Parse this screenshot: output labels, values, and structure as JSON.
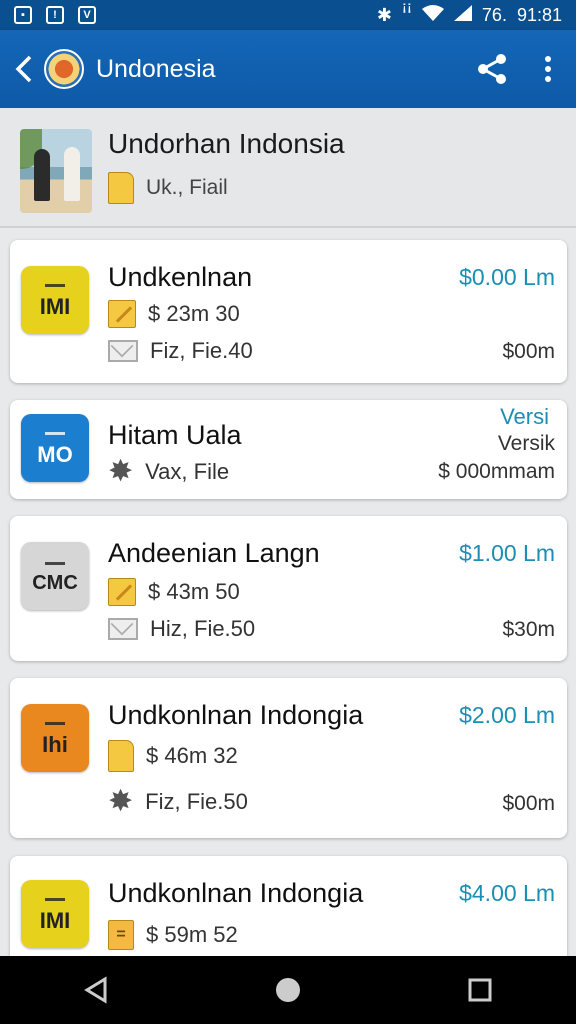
{
  "status": {
    "carrier": "76.",
    "time": "91:81",
    "icons": [
      "sim-icon",
      "alert-icon",
      "vibrate-icon",
      "bluetooth-icon",
      "signal-icon",
      "wifi-icon",
      "cellular-icon"
    ]
  },
  "appbar": {
    "title": "Undonesia",
    "icons": [
      "back-arrow-icon",
      "share-icon",
      "overflow-menu-icon"
    ]
  },
  "header": {
    "title": "Undorhan Indonsia",
    "subtitle": "Uk., Fiail"
  },
  "items": [
    {
      "icon_label": "IMI",
      "icon_color": "#e6d21c",
      "title": "Undkenlnan",
      "price": "$0.00 Lm",
      "line1": "$ 23m 30",
      "line1_icon": "pencil-icon",
      "line2": "Fiz, Fie.40",
      "line2_icon": "mail-icon",
      "line2_right": "$00m"
    },
    {
      "icon_label": "MO",
      "icon_color": "#1b7ecf",
      "title": "Hitam Uala",
      "price": "Versi",
      "price_sub": "Versik",
      "line1": "Vax, File",
      "line1_icon": "gear-icon",
      "line1_right": "$ 000mmam"
    },
    {
      "icon_label": "CMC",
      "icon_color": "#d6d6d6",
      "title": "Andeenian Langn",
      "price": "$1.00 Lm",
      "line1": "$ 43m 50",
      "line1_icon": "pencil-icon",
      "line2": "Hiz, Fie.50",
      "line2_icon": "mail-icon",
      "line2_right": "$30m"
    },
    {
      "icon_label": "Ihi",
      "icon_color": "#e8881e",
      "title": "Undkonlnan Indongia",
      "price": "$2.00 Lm",
      "line1": "$ 46m 32",
      "line1_icon": "file-icon",
      "line2": "Fiz, Fie.50",
      "line2_icon": "gear-icon",
      "line2_right": "$00m"
    },
    {
      "icon_label": "IMI",
      "icon_color": "#e6d21c",
      "title": "Undkonlnan Indongia",
      "price": "$4.00 Lm",
      "line1": "$ 59m 52",
      "line1_icon": "document-icon"
    }
  ],
  "navbar": {
    "icons": [
      "nav-back-icon",
      "nav-home-icon",
      "nav-recents-icon"
    ]
  },
  "colors": {
    "appbar": "#1566b8",
    "price": "#1a8fb3"
  }
}
